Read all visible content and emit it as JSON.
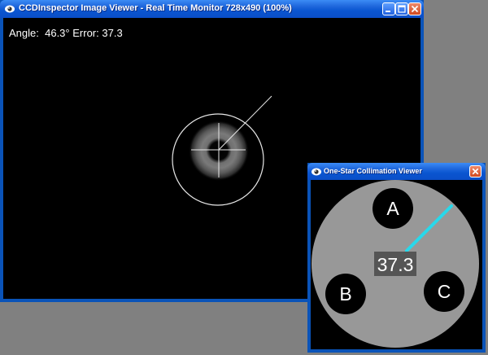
{
  "main_window": {
    "title": "CCDInspector Image Viewer - Real Time Monitor 728x490 (100%)",
    "angle_label": "Angle:",
    "angle_value": "46.3°",
    "error_label": "Error:",
    "error_value": "37.3"
  },
  "collimation_window": {
    "title": "One-Star Collimation Viewer",
    "error_readout": "37.3",
    "zones": [
      "A",
      "B",
      "C"
    ]
  },
  "colors": {
    "indicator": "#29d8ea",
    "disc": "#989898"
  },
  "icons": [
    "app-icon",
    "minimize-icon",
    "maximize-icon",
    "close-icon"
  ]
}
